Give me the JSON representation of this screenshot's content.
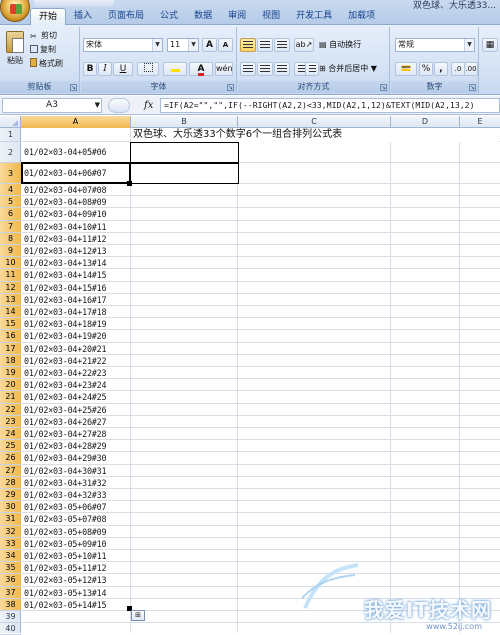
{
  "window": {
    "title": "双色球、大乐透33..."
  },
  "ribbon": {
    "tabs": [
      "开始",
      "插入",
      "页面布局",
      "公式",
      "数据",
      "审阅",
      "视图",
      "开发工具",
      "加载项"
    ],
    "clipboard": {
      "paste": "粘贴",
      "cut": "剪切",
      "copy": "复制",
      "format_painter": "格式刷",
      "label": "剪贴板"
    },
    "font": {
      "name": "宋体",
      "size": "11",
      "grow": "A",
      "shrink": "A",
      "bold": "B",
      "italic": "I",
      "underline": "U",
      "label": "字体"
    },
    "alignment": {
      "wrap": "自动换行",
      "merge": "合并后居中",
      "label": "对齐方式"
    },
    "number": {
      "format": "常规",
      "percent": "%",
      "comma": ",",
      "label": "数字"
    }
  },
  "formula_bar": {
    "name_box": "A3",
    "fx": "fx",
    "formula": "=IF(A2=\"\",\"\",IF(--RIGHT(A2,2)<33,MID(A2,1,12)&TEXT(MID(A2,13,2)"
  },
  "sheet": {
    "columns": [
      "A",
      "B",
      "C",
      "D",
      "E"
    ],
    "rows": [
      "1",
      "2",
      "3",
      "4",
      "5",
      "6",
      "7",
      "8",
      "9",
      "10",
      "11",
      "12",
      "13",
      "14",
      "15",
      "16",
      "17",
      "18",
      "19",
      "20",
      "21",
      "22",
      "23",
      "24",
      "25",
      "26",
      "27",
      "28",
      "29",
      "30",
      "31",
      "32",
      "33",
      "34",
      "35",
      "36",
      "37",
      "38",
      "39",
      "40"
    ],
    "title": "双色球、大乐透33个数字6个一组合排列公式表",
    "column_a": [
      "01/02×03-04+05#06",
      "01/02×03-04+06#07",
      "01/02×03-04+07#08",
      "01/02×03-04+08#09",
      "01/02×03-04+09#10",
      "01/02×03-04+10#11",
      "01/02×03-04+11#12",
      "01/02×03-04+12#13",
      "01/02×03-04+13#14",
      "01/02×03-04+14#15",
      "01/02×03-04+15#16",
      "01/02×03-04+16#17",
      "01/02×03-04+17#18",
      "01/02×03-04+18#19",
      "01/02×03-04+19#20",
      "01/02×03-04+20#21",
      "01/02×03-04+21#22",
      "01/02×03-04+22#23",
      "01/02×03-04+23#24",
      "01/02×03-04+24#25",
      "01/02×03-04+25#26",
      "01/02×03-04+26#27",
      "01/02×03-04+27#28",
      "01/02×03-04+28#29",
      "01/02×03-04+29#30",
      "01/02×03-04+30#31",
      "01/02×03-04+31#32",
      "01/02×03-04+32#33",
      "01/02×03-05+06#07",
      "01/02×03-05+07#08",
      "01/02×03-05+08#09",
      "01/02×03-05+09#10",
      "01/02×03-05+10#11",
      "01/02×03-05+11#12",
      "01/02×03-05+12#13",
      "01/02×03-05+13#14",
      "01/02×03-05+14#15"
    ]
  },
  "watermark": {
    "text": "我爱IT技术网",
    "url": "www.52ij.com"
  }
}
